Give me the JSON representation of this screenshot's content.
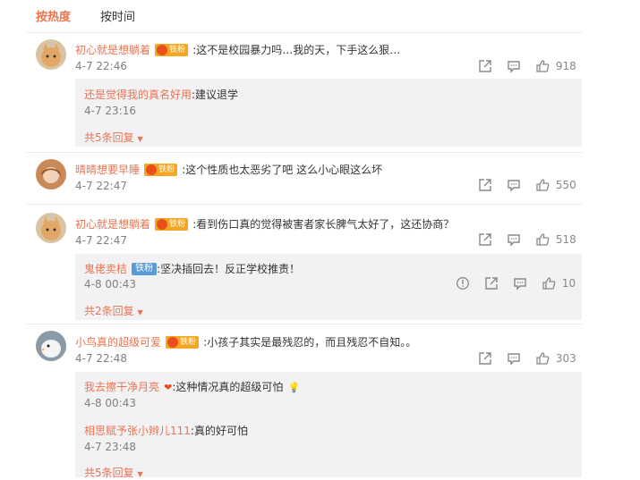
{
  "tabs": {
    "hot": "按热度",
    "time": "按时间"
  },
  "comments": [
    {
      "name": "初心就是想躺着",
      "badge": "铁粉",
      "text": ":这不是校园暴力吗…我的天，下手这么狠…",
      "time": "4-7 22:46",
      "likes": "918",
      "replies": [
        {
          "name": "还是觉得我的真名好用",
          "text": ":建议退学",
          "time": "4-7 23:16"
        }
      ],
      "more": "共5条回复"
    },
    {
      "name": "晴晴想要早睡",
      "badge": "铁粉",
      "text": ":这个性质也太恶劣了吧 这么小心眼这么坏",
      "time": "4-7 22:47",
      "likes": "550"
    },
    {
      "name": "初心就是想躺着",
      "badge": "铁粉",
      "text": ":看到伤口真的觉得被害者家长脾气太好了，这还协商？",
      "time": "4-7 22:47",
      "likes": "518",
      "replies": [
        {
          "name": "鬼佬卖桔",
          "badge": "铁粉",
          "text": ":坚决插回去！反正学校推责！",
          "time": "4-8 00:43",
          "likes": "10"
        }
      ],
      "more": "共2条回复"
    },
    {
      "name": "小鸟真的超级可爱",
      "badge": "铁粉",
      "text": ":小孩子其实是最残忍的，而且残忍不自知。。",
      "time": "4-7 22:48",
      "likes": "303",
      "replies": [
        {
          "name": "我去擦干净月亮",
          "text": ":这种情况真的超级可怕",
          "time": "4-8 00:43"
        },
        {
          "name": "相思赋予张小辫儿111",
          "text": ":真的好可怕",
          "time": "4-7 23:48"
        }
      ],
      "more": "共5条回复"
    }
  ]
}
